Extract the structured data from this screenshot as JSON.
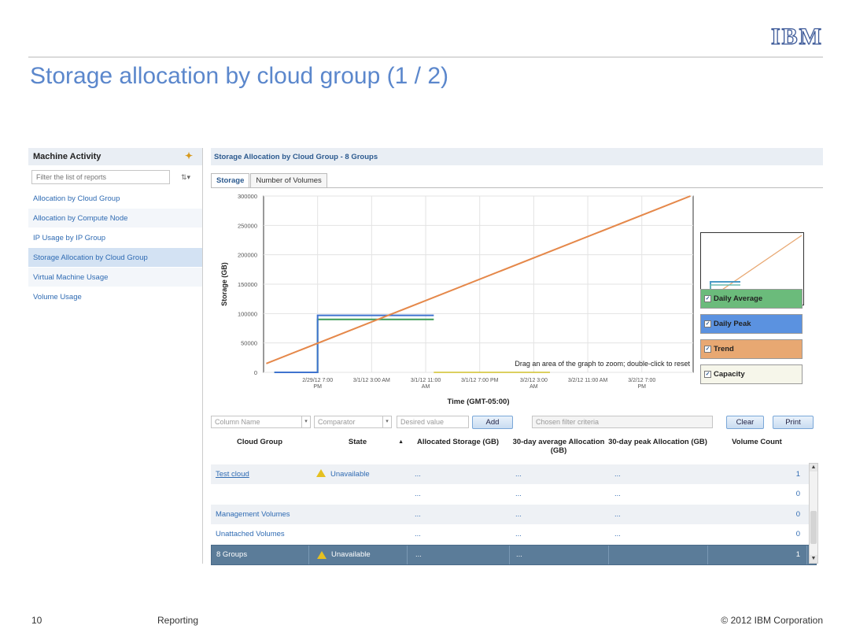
{
  "slide": {
    "logo": "IBM",
    "title": "Storage allocation by cloud group (1 / 2)",
    "page_number": "10",
    "section": "Reporting",
    "copyright": "© 2012 IBM Corporation"
  },
  "sidebar": {
    "title": "Machine Activity",
    "filter_placeholder": "Filter the list of reports",
    "items": [
      {
        "label": "Allocation by Cloud Group"
      },
      {
        "label": "Allocation by Compute Node"
      },
      {
        "label": "IP Usage by IP Group"
      },
      {
        "label": "Storage Allocation by Cloud Group"
      },
      {
        "label": "Virtual Machine Usage"
      },
      {
        "label": "Volume Usage"
      }
    ]
  },
  "main": {
    "header": "Storage Allocation by Cloud Group - 8 Groups",
    "tabs": [
      {
        "label": "Storage"
      },
      {
        "label": "Number of Volumes"
      }
    ]
  },
  "legend": {
    "items": [
      {
        "label": "Daily Average",
        "color": "#6bbb7b"
      },
      {
        "label": "Daily Peak",
        "color": "#5b92e0"
      },
      {
        "label": "Trend",
        "color": "#e8a872"
      },
      {
        "label": "Capacity",
        "color": "#f6f6ea"
      }
    ]
  },
  "chart_data": {
    "type": "line",
    "ylabel": "Storage (GB)",
    "xlabel": "Time (GMT-05:00)",
    "ylim": [
      0,
      300000
    ],
    "yticks": [
      0,
      50000,
      100000,
      150000,
      200000,
      250000,
      300000
    ],
    "xticks": [
      "2/29/12 7:00 PM",
      "3/1/12 3:00 AM",
      "3/1/12 11:00 AM",
      "3/1/12 7:00 PM",
      "3/2/12 3:00 AM",
      "3/2/12 11:00 AM",
      "3/2/12 7:00 PM"
    ],
    "hint": "Drag an area of the graph to zoom; double-click to reset",
    "grid": true,
    "series": [
      {
        "name": "Daily Average",
        "color": "#3a9a55",
        "points": [
          [
            -0.8,
            0
          ],
          [
            0.0,
            0
          ],
          [
            0.0,
            90000
          ],
          [
            2.15,
            90000
          ]
        ]
      },
      {
        "name": "Daily Peak",
        "color": "#3f73cf",
        "points": [
          [
            -0.8,
            0
          ],
          [
            0.0,
            0
          ],
          [
            0.0,
            97000
          ],
          [
            2.15,
            97000
          ]
        ]
      },
      {
        "name": "Trend",
        "color": "#e5884a",
        "points": [
          [
            -0.95,
            15000
          ],
          [
            6.9,
            300000
          ]
        ]
      }
    ],
    "capacity_segment": {
      "color": "#c8b400",
      "points": [
        [
          2.15,
          0
        ],
        [
          4.3,
          0
        ]
      ]
    }
  },
  "filter": {
    "column_placeholder": "Column Name",
    "comparator_placeholder": "Comparator",
    "value_placeholder": "Desired value",
    "add_label": "Add",
    "criteria_placeholder": "Chosen filter criteria",
    "clear_label": "Clear",
    "print_label": "Print"
  },
  "table": {
    "headers": [
      "Cloud Group",
      "State",
      "Allocated Storage (GB)",
      "30-day average Allocation (GB)",
      "30-day peak Allocation (GB)",
      "Volume Count"
    ],
    "sort_indicator": "▲",
    "rows": [
      {
        "group": "Test cloud",
        "state": "Unavailable",
        "allocated": "...",
        "avg": "...",
        "peak": "...",
        "count": "1"
      },
      {
        "group": "",
        "state": "",
        "allocated": "...",
        "avg": "...",
        "peak": "...",
        "count": "0"
      },
      {
        "group": "Management Volumes",
        "state": "",
        "allocated": "...",
        "avg": "...",
        "peak": "...",
        "count": "0"
      },
      {
        "group": "Unattached Volumes",
        "state": "",
        "allocated": "...",
        "avg": "...",
        "peak": "...",
        "count": "0"
      }
    ],
    "total": {
      "group": "8 Groups",
      "state": "Unavailable",
      "allocated": "...",
      "avg": "...",
      "peak": "",
      "count": "1"
    }
  }
}
